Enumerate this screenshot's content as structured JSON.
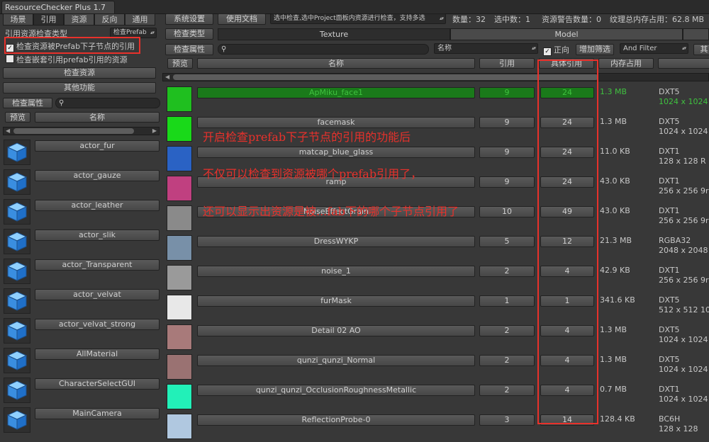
{
  "window": {
    "title": "ResourceChecker Plus 1.7"
  },
  "left_tabs": [
    {
      "label": "场景",
      "selected": false
    },
    {
      "label": "引用",
      "selected": true
    },
    {
      "label": "资源",
      "selected": false
    },
    {
      "label": "反向",
      "selected": false
    },
    {
      "label": "通用",
      "selected": false
    }
  ],
  "left_panel": {
    "ref_type_label": "引用资源检查类型",
    "ref_type_value": "检查Prefab",
    "prefab_child_toggle": "检查资源被Prefab下子节点的引用",
    "prefab_child_checked": true,
    "check_nested_label": "检查嵌套引用prefab引用的资源",
    "check_resources_button": "检查资源",
    "other_functions_button": "其他功能",
    "check_attr_button": "检查属性",
    "search_placeholder": "",
    "col_preview": "预览",
    "col_name": "名称",
    "items": [
      "actor_fur",
      "actor_gauze",
      "actor_leather",
      "actor_slik",
      "actor_Transparent",
      "actor_velvat",
      "actor_velvat_strong",
      "AllMaterial",
      "CharacterSelectGUI",
      "MainCamera"
    ]
  },
  "toolbar": {
    "settings_button": "系统设置",
    "docs_button": "使用文档",
    "mode_dropdown": "选中检查,选中Project面板内资源进行检查，支持多选",
    "count_label": "数量：32",
    "selected_label": "选中数：1",
    "warning_label": "资源警告数量：0",
    "memory_label": "纹理总内存占用：62.8 MB"
  },
  "type_row": {
    "check_type_button": "检查类型",
    "tabs": [
      {
        "label": "Texture",
        "selected": true
      },
      {
        "label": "Model",
        "selected": false
      }
    ]
  },
  "filter_row": {
    "check_attr_button": "检查属性",
    "search_placeholder": "",
    "sort_field": "名称",
    "forward_label": "正向",
    "forward_checked": true,
    "add_filter_button": "增加筛选",
    "and_filter": "And Filter",
    "other_button": "其"
  },
  "table": {
    "headers": {
      "preview": "预览",
      "name": "名称",
      "refs": "引用",
      "detail_refs": "具体引用",
      "memory": "内存占用"
    },
    "rows": [
      {
        "name": "ApMiku_face1",
        "refs": "9",
        "detail": "24",
        "memory": "1.3 MB",
        "format": "DXT5",
        "size": "1024 x 1024",
        "selected": true,
        "thumb": "#1fbf1f"
      },
      {
        "name": "facemask",
        "refs": "9",
        "detail": "24",
        "memory": "1.3 MB",
        "format": "DXT5",
        "size": "1024 x 1024",
        "selected": false,
        "thumb": "#19d919"
      },
      {
        "name": "matcap_blue_glass",
        "refs": "9",
        "detail": "24",
        "memory": "11.0 KB",
        "format": "DXT1",
        "size": "128 x 128 R",
        "selected": false,
        "thumb": "#2a62c4"
      },
      {
        "name": "ramp",
        "refs": "9",
        "detail": "24",
        "memory": "43.0 KB",
        "format": "DXT1",
        "size": "256 x 256 9r",
        "selected": false,
        "thumb": "#c04080"
      },
      {
        "name": "NoiseEffectGrain",
        "refs": "10",
        "detail": "49",
        "memory": "43.0 KB",
        "format": "DXT1",
        "size": "256 x 256 9r",
        "selected": false,
        "thumb": "#8a8a8a"
      },
      {
        "name": "DressWYKP",
        "refs": "5",
        "detail": "12",
        "memory": "21.3 MB",
        "format": "RGBA32",
        "size": "2048 x 2048",
        "selected": false,
        "thumb": "#7890a8"
      },
      {
        "name": "noise_1",
        "refs": "2",
        "detail": "4",
        "memory": "42.9 KB",
        "format": "DXT1",
        "size": "256 x 256 9r",
        "selected": false,
        "thumb": "#9a9a9a"
      },
      {
        "name": "furMask",
        "refs": "1",
        "detail": "1",
        "memory": "341.6 KB",
        "format": "DXT5",
        "size": "512 x 512 10",
        "selected": false,
        "thumb": "#e8e8e8"
      },
      {
        "name": "Detail 02 AO",
        "refs": "2",
        "detail": "4",
        "memory": "1.3 MB",
        "format": "DXT5",
        "size": "1024 x 1024",
        "selected": false,
        "thumb": "#a87a7a"
      },
      {
        "name": "qunzi_qunzi_Normal",
        "refs": "2",
        "detail": "4",
        "memory": "1.3 MB",
        "format": "DXT5",
        "size": "1024 x 1024",
        "selected": false,
        "thumb": "#9a7272"
      },
      {
        "name": "qunzi_qunzi_OcclusionRoughnessMetallic",
        "refs": "2",
        "detail": "4",
        "memory": "0.7 MB",
        "format": "DXT1",
        "size": "1024 x 1024",
        "selected": false,
        "thumb": "#22f0b8"
      },
      {
        "name": "ReflectionProbe-0",
        "refs": "3",
        "detail": "14",
        "memory": "128.4 KB",
        "format": "BC6H",
        "size": "128 x 128",
        "selected": false,
        "thumb": "#b0c8e0"
      }
    ]
  },
  "annotations": {
    "line1": "开启检查prefab下子节点的引用的功能后",
    "line2": "不仅可以检查到资源被哪个prefab引用了，",
    "line3": "还可以显示出资源是被...fab下的哪个子节点引用了"
  },
  "colors": {
    "annotation_red": "#e8312b",
    "selected_row_green": "#1a7a1a",
    "selected_text_green": "#3fc13f"
  }
}
